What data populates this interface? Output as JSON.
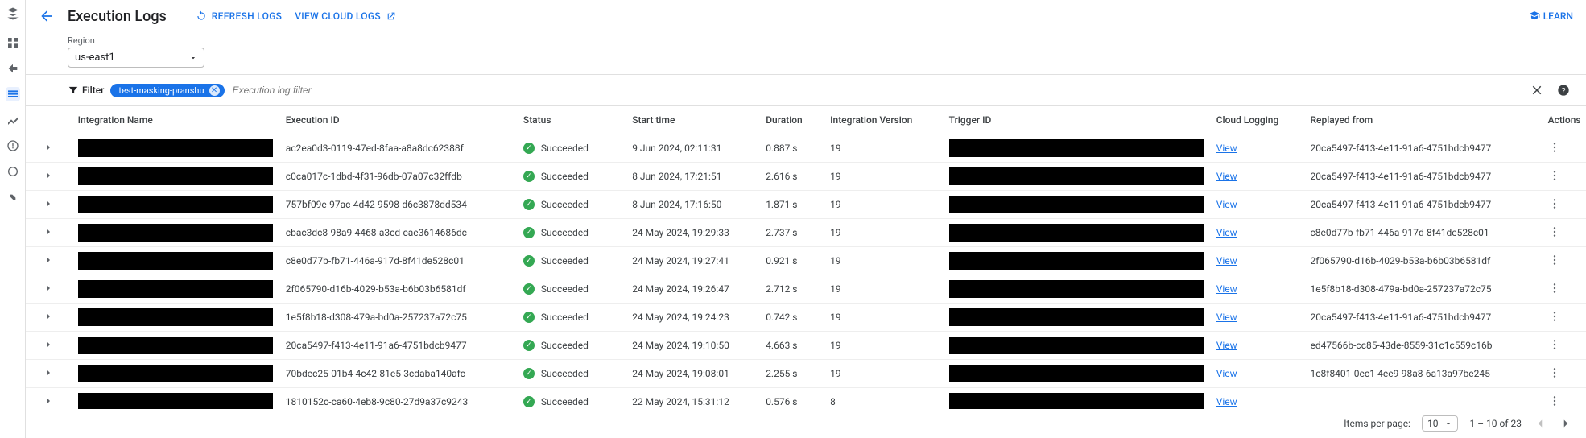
{
  "header": {
    "title": "Execution Logs",
    "refresh": "REFRESH LOGS",
    "viewCloud": "VIEW CLOUD LOGS",
    "learn": "LEARN"
  },
  "region": {
    "label": "Region",
    "value": "us-east1"
  },
  "filter": {
    "button": "Filter",
    "chip": "test-masking-pranshu",
    "placeholder": "Execution log filter"
  },
  "columns": {
    "name": "Integration Name",
    "exec": "Execution ID",
    "status": "Status",
    "start": "Start time",
    "dur": "Duration",
    "ver": "Integration Version",
    "trig": "Trigger ID",
    "log": "Cloud Logging",
    "rep": "Replayed from",
    "act": "Actions"
  },
  "statusLabel": "Succeeded",
  "viewLabel": "View",
  "rows": [
    {
      "exec": "ac2ea0d3-0119-47ed-8faa-a8a8dc62388f",
      "start": "9 Jun 2024, 02:11:31",
      "dur": "0.887 s",
      "ver": "19",
      "rep": "20ca5497-f413-4e11-91a6-4751bdcb9477"
    },
    {
      "exec": "c0ca017c-1dbd-4f31-96db-07a07c32ffdb",
      "start": "8 Jun 2024, 17:21:51",
      "dur": "2.616 s",
      "ver": "19",
      "rep": "20ca5497-f413-4e11-91a6-4751bdcb9477"
    },
    {
      "exec": "757bf09e-97ac-4d42-9598-d6c3878dd534",
      "start": "8 Jun 2024, 17:16:50",
      "dur": "1.871 s",
      "ver": "19",
      "rep": "20ca5497-f413-4e11-91a6-4751bdcb9477"
    },
    {
      "exec": "cbac3dc8-98a9-4468-a3cd-cae3614686dc",
      "start": "24 May 2024, 19:29:33",
      "dur": "2.737 s",
      "ver": "19",
      "rep": "c8e0d77b-fb71-446a-917d-8f41de528c01"
    },
    {
      "exec": "c8e0d77b-fb71-446a-917d-8f41de528c01",
      "start": "24 May 2024, 19:27:41",
      "dur": "0.921 s",
      "ver": "19",
      "rep": "2f065790-d16b-4029-b53a-b6b03b6581df"
    },
    {
      "exec": "2f065790-d16b-4029-b53a-b6b03b6581df",
      "start": "24 May 2024, 19:26:47",
      "dur": "2.712 s",
      "ver": "19",
      "rep": "1e5f8b18-d308-479a-bd0a-257237a72c75"
    },
    {
      "exec": "1e5f8b18-d308-479a-bd0a-257237a72c75",
      "start": "24 May 2024, 19:24:23",
      "dur": "0.742 s",
      "ver": "19",
      "rep": "20ca5497-f413-4e11-91a6-4751bdcb9477"
    },
    {
      "exec": "20ca5497-f413-4e11-91a6-4751bdcb9477",
      "start": "24 May 2024, 19:10:50",
      "dur": "4.663 s",
      "ver": "19",
      "rep": "ed47566b-cc85-43de-8559-31c1c559c16b"
    },
    {
      "exec": "70bdec25-01b4-4c42-81e5-3cdaba140afc",
      "start": "24 May 2024, 19:08:01",
      "dur": "2.255 s",
      "ver": "19",
      "rep": "1c8f8401-0ec1-4ee9-98a8-6a13a97be245"
    },
    {
      "exec": "1810152c-ca60-4eb8-9c80-27d9a37c9243",
      "start": "22 May 2024, 15:31:12",
      "dur": "0.576 s",
      "ver": "8",
      "rep": ""
    }
  ],
  "pager": {
    "label": "Items per page:",
    "perPage": "10",
    "range": "1 – 10 of 23"
  }
}
